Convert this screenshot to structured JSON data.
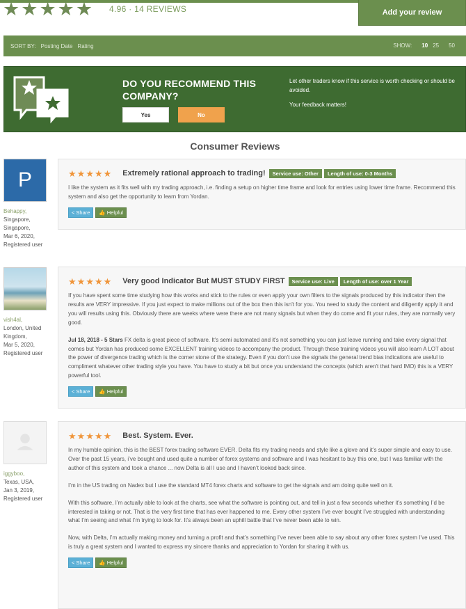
{
  "summary": {
    "rating_text": "4.96 · 14 REVIEWS",
    "stars": 5,
    "add_review_label": "Add your review"
  },
  "sortbar": {
    "sort_by_label": "SORT BY:",
    "sort_options": [
      "Posting Date",
      "Rating"
    ],
    "show_label": "SHOW:",
    "show_options": [
      "10",
      "25",
      "50"
    ],
    "show_selected": "10"
  },
  "recommend": {
    "question": "DO YOU RECOMMEND THIS COMPANY?",
    "yes_label": "Yes",
    "no_label": "No",
    "note_1": "Let other traders know if this service is worth checking or should be avoided.",
    "note_2": "Your feedback matters!"
  },
  "section_title": "Consumer Reviews",
  "colors": {
    "brand_green": "#6b8f4e",
    "dark_green": "#3e6b31",
    "star_orange": "#f0953a",
    "no_orange": "#f0a24c",
    "share_blue": "#5bb0d6"
  },
  "reviews": [
    {
      "user": {
        "avatar_letter": "P",
        "name": "Behappy,",
        "location": "Singapore, Singapore,",
        "date": "Mar 6, 2020,",
        "status": "Registered user"
      },
      "stars": 5,
      "title": "Extremely rational approach to trading!",
      "badges": [
        "Service use: Other",
        "Length of use: 0-3 Months"
      ],
      "paragraphs": [
        {
          "lead": "",
          "text": "I like the system as it fits well with my trading approach, i.e. finding a setup on higher time frame and look for entries using lower time frame. Recommend this system and also get the opportunity to learn from Yordan."
        }
      ],
      "share_label": "Share",
      "helpful_label": "Helpful"
    },
    {
      "user": {
        "avatar_letter": "",
        "name": "vish4al,",
        "location": "London, United Kingdom,",
        "date": "Mar 5, 2020,",
        "status": "Registered user"
      },
      "stars": 5,
      "title": "Very good Indicator But MUST STUDY FIRST",
      "badges": [
        "Service use: Live",
        "Length of use: over 1 Year"
      ],
      "paragraphs": [
        {
          "lead": "",
          "text": "If you have spent some time studying how this works and stick to the rules or even apply your own filters to the signals produced by this indicator then the results are VERY impressive. If you just expect to make millions out of the box then this isn't for you. You need to study the content and diligently apply it and you will results using this. Obviously there are weeks where were there are not many signals but when they do come and fit your rules, they are normally very good."
        },
        {
          "lead": "Jul 18, 2018 - 5 Stars",
          "text": " FX delta is great piece of software. It's semi automated and it's not something you can just leave running and take every signal that comes but Yordan has produced some EXCELLENT training videos to accompany the product. Through these training videos you will also learn A LOT about the power of divergence trading which is the corner stone of the strategy. Even if you don't use the signals the general trend bias indications are useful to compliment whatever other trading style you have. You have to study a bit but once you understand the concepts (which aren't that hard IMO) this is a VERY powerful tool."
        }
      ],
      "share_label": "Share",
      "helpful_label": "Helpful"
    },
    {
      "user": {
        "avatar_letter": "",
        "name": "iggyboo,",
        "location": "Texas, USA,",
        "date": "Jan 3, 2019,",
        "status": "Registered user"
      },
      "stars": 5,
      "title": "Best. System. Ever.",
      "badges": [],
      "paragraphs": [
        {
          "lead": "",
          "text": "In my humble opinion, this is the BEST forex trading software EVER. Delta fits my trading needs and style like a glove and it’s super simple and easy to use. Over the past 15 years, i’ve bought and used quite a number of forex systems and software and I was hesitant to buy this one, but I was familiar with the author of this system and took a chance ... now Delta is all I use and I haven’t looked back since."
        },
        {
          "lead": "",
          "text": "I’m in the US trading on Nadex but I use the standard MT4 forex charts and software to get the signals and am doing quite well on it."
        },
        {
          "lead": "",
          "text": "With this software, I’m actually able to look at the charts, see what the software is pointing out, and tell in just a few seconds whether it’s something I’d be interested in taking or not. That is the very first time that has ever happened to me. Every other system I’ve ever bought I’ve struggled with understanding what I’m seeing and what I’m trying to look for. It’s always been an uphill battle that I’ve never been able to win."
        },
        {
          "lead": "",
          "text": "Now, with Delta, I’m actually making money and turning a profit and that’s something I’ve never been able to say about any other forex system I’ve used. This is truly a great system and I wanted to express my sincere thanks and appreciation to Yordan for sharing it with us."
        }
      ],
      "share_label": "Share",
      "helpful_label": "Helpful"
    }
  ]
}
